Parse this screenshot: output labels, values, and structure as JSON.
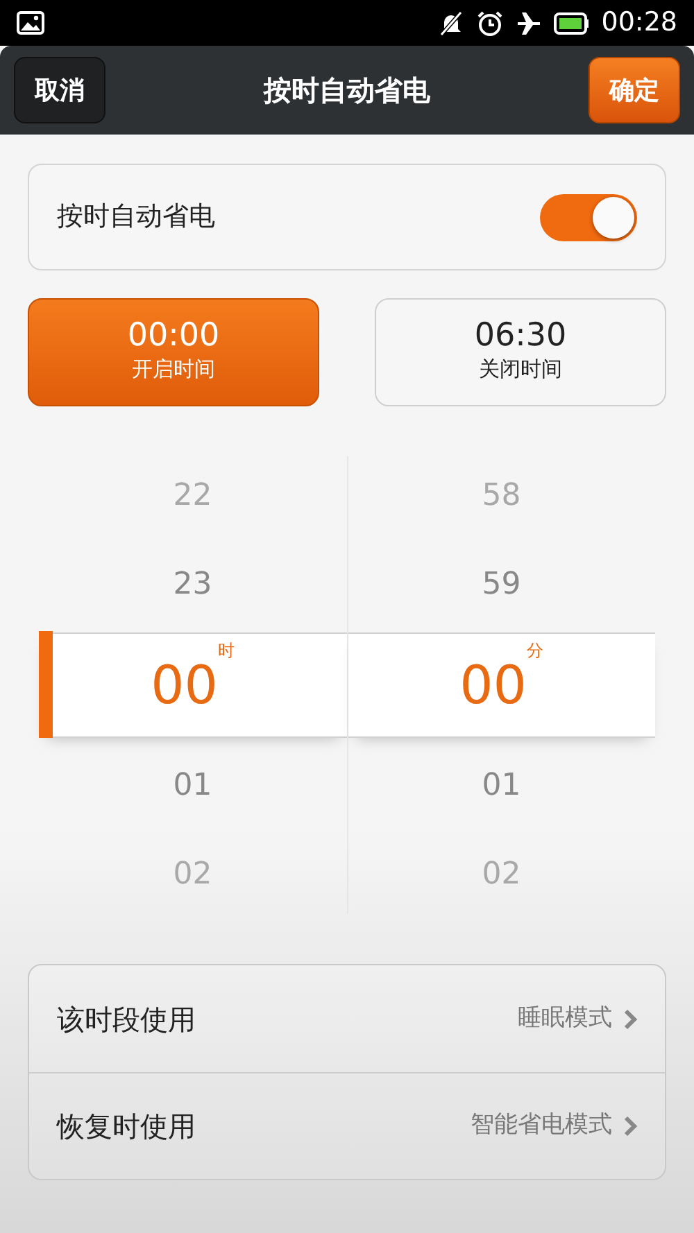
{
  "status_bar": {
    "time": "00:28"
  },
  "header": {
    "cancel": "取消",
    "title": "按时自动省电",
    "confirm": "确定"
  },
  "toggle": {
    "label": "按时自动省电",
    "on": true
  },
  "time_tabs": [
    {
      "time": "00:00",
      "label": "开启时间",
      "selected": true
    },
    {
      "time": "06:30",
      "label": "关闭时间",
      "selected": false
    }
  ],
  "picker": [
    {
      "unit": "时",
      "items": [
        {
          "value": "22",
          "selected": false
        },
        {
          "value": "23",
          "selected": false
        },
        {
          "value": "00",
          "selected": true
        },
        {
          "value": "01",
          "selected": false
        },
        {
          "value": "02",
          "selected": false
        }
      ]
    },
    {
      "unit": "分",
      "items": [
        {
          "value": "58",
          "selected": false
        },
        {
          "value": "59",
          "selected": false
        },
        {
          "value": "00",
          "selected": true
        },
        {
          "value": "01",
          "selected": false
        },
        {
          "value": "02",
          "selected": false
        }
      ]
    }
  ],
  "settings": [
    {
      "label": "该时段使用",
      "value": "睡眠模式"
    },
    {
      "label": "恢复时使用",
      "value": "智能省电模式"
    }
  ]
}
